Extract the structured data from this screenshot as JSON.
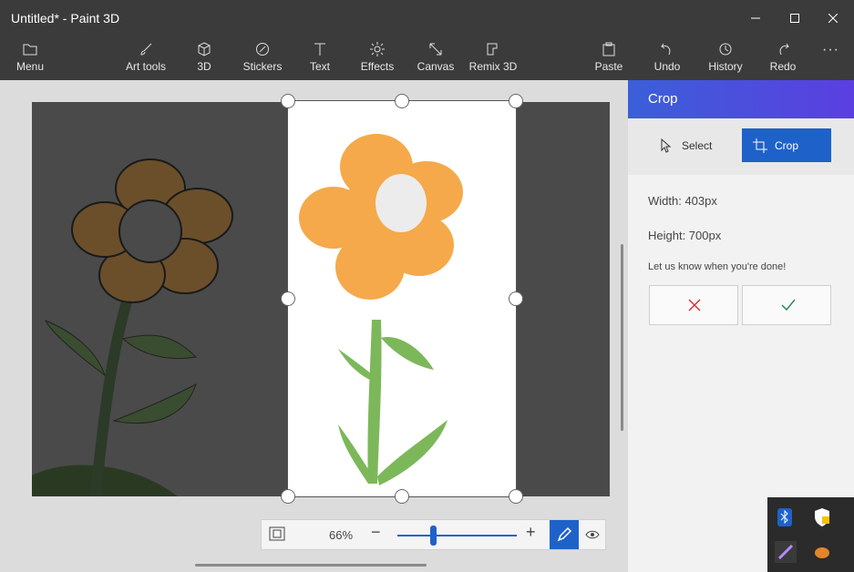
{
  "window": {
    "title": "Untitled* - Paint 3D"
  },
  "toolbar": {
    "menu": "Menu",
    "art_tools": "Art tools",
    "three_d": "3D",
    "stickers": "Stickers",
    "text": "Text",
    "effects": "Effects",
    "canvas": "Canvas",
    "remix": "Remix 3D",
    "paste": "Paste",
    "undo": "Undo",
    "history": "History",
    "redo": "Redo",
    "more": "···"
  },
  "panel": {
    "title": "Crop",
    "select_label": "Select",
    "crop_label": "Crop",
    "width": "Width: 403px",
    "height": "Height: 700px",
    "hint": "Let us know when you're done!"
  },
  "zoom": {
    "percent": "66%",
    "level": 0.3
  },
  "colors": {
    "accent": "#1e62c9",
    "header_start": "#3b5fd8",
    "header_end": "#5b3fe0",
    "petal": "#f5a94a",
    "stem": "#7cb85a"
  }
}
